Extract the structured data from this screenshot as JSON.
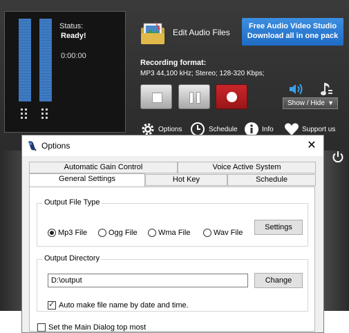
{
  "recorder": {
    "status_label": "Status:",
    "status_value": "Ready!",
    "timer": "0:00:00",
    "edit_audio_label": "Edit Audio Files",
    "promo": {
      "line1": "Free Audio Video Studio",
      "line2": "Download all in one pack",
      "color": "#2b7fd6"
    },
    "recording_format_title": "Recording format:",
    "recording_format_value": "MP3 44,100 kHz; Stereo;  128-320 Kbps;",
    "show_hide_label": "Show / Hide",
    "toolbar": {
      "options": "Options",
      "schedule": "Schedule",
      "info": "Info",
      "support": "Support us"
    },
    "meter_color": "#3e7bc4",
    "record_color": "#c8262a"
  },
  "dialog": {
    "title": "Options",
    "close_glyph": "✕",
    "tabs_row1": [
      "Automatic Gain Control",
      "Voice Active System"
    ],
    "tabs_row2": [
      "General Settings",
      "Hot Key",
      "Schedule"
    ],
    "active_tab": "General Settings",
    "output_file_type": {
      "title": "Output File Type",
      "options": [
        "Mp3 File",
        "Ogg File",
        "Wma File",
        "Wav File"
      ],
      "selected": "Mp3 File",
      "settings_button": "Settings"
    },
    "output_directory": {
      "title": "Output Directory",
      "value": "D:\\output",
      "change_button": "Change",
      "auto_name_label": "Auto make file name by date and time.",
      "auto_name_checked": true
    },
    "top_most_label": "Set the Main Dialog top most",
    "top_most_checked": false
  }
}
